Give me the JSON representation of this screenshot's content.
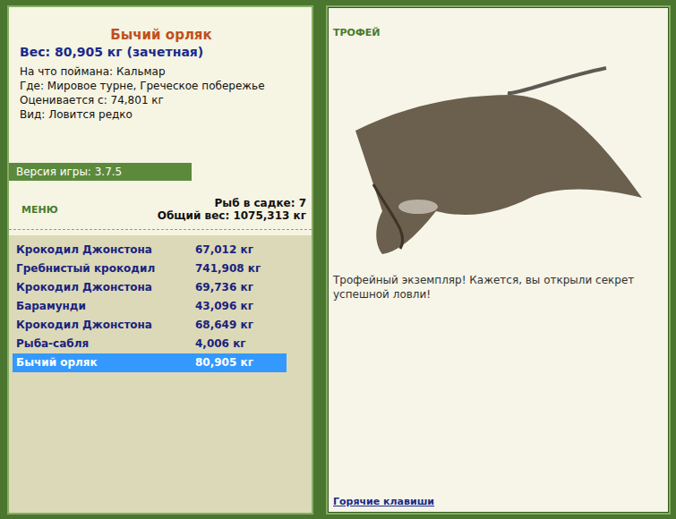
{
  "fish_info": {
    "name": "Бычий орляк",
    "weight": "Вес: 80,905 кг (зачетная)",
    "details": [
      "На что поймана: Кальмар",
      "Где: Мировое турне, Греческое побережье",
      "Оценивается с: 74,801 кг",
      "Вид: Ловится редко"
    ]
  },
  "version": "Версия игры: 3.7.5",
  "menu": "МЕНЮ",
  "keepnet": {
    "count": "Рыб в садке: 7",
    "total": "Общий вес: 1075,313 кг"
  },
  "catch_list": [
    {
      "name": "Крокодил Джонстона",
      "weight": "67,012 кг",
      "selected": false
    },
    {
      "name": "Гребнистый крокодил",
      "weight": "741,908 кг",
      "selected": false
    },
    {
      "name": "Крокодил Джонстона",
      "weight": "69,736 кг",
      "selected": false
    },
    {
      "name": "Барамунди",
      "weight": "43,096 кг",
      "selected": false
    },
    {
      "name": "Крокодил Джонстона",
      "weight": "68,649 кг",
      "selected": false
    },
    {
      "name": "Рыба-сабля",
      "weight": "4,006 кг",
      "selected": false
    },
    {
      "name": "Бычий орляк",
      "weight": "80,905 кг",
      "selected": true
    }
  ],
  "trophy": {
    "label": "ТРОФЕЙ",
    "message": "Трофейный экземпляр! Кажется, вы открыли секрет успешной ловли!"
  },
  "hotkeys_link": "Горячие клавиши"
}
